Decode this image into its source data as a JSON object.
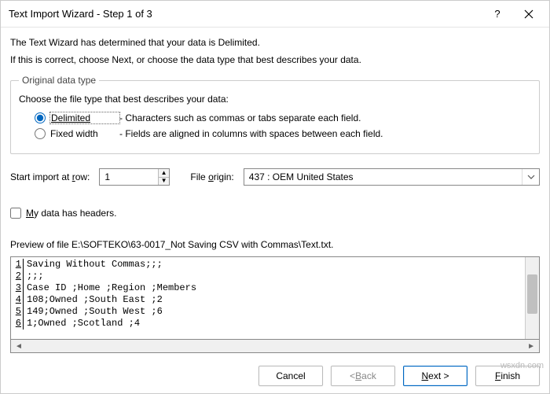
{
  "titlebar": {
    "title": "Text Import Wizard - Step 1 of 3"
  },
  "intro": {
    "line1": "The Text Wizard has determined that your data is Delimited.",
    "line2": "If this is correct, choose Next, or choose the data type that best describes your data."
  },
  "group": {
    "legend": "Original data type",
    "choose": "Choose the file type that best describes your data:",
    "delimited": {
      "label": "Delimited",
      "desc": "- Characters such as commas or tabs separate each field."
    },
    "fixed": {
      "label": "Fixed width",
      "desc": "- Fields are aligned in columns with spaces between each field."
    }
  },
  "row2": {
    "start_label": "Start import at row:",
    "start_value": "1",
    "origin_label": "File origin:",
    "origin_value": "437 : OEM United States"
  },
  "headers": {
    "label": "My data has headers."
  },
  "preview": {
    "label": "Preview of file E:\\SOFTEKO\\63-0017_Not Saving CSV with Commas\\Text.txt.",
    "lines": [
      "Saving Without Commas;;;",
      ";;;",
      "Case ID ;Home ;Region ;Members",
      "108;Owned ;South East ;2",
      "149;Owned ;South West ;6",
      "1;Owned ;Scotland ;4"
    ]
  },
  "buttons": {
    "cancel": "Cancel",
    "back": "< Back",
    "next": "Next >",
    "finish": "Finish"
  },
  "watermark": "wsxdn.com"
}
